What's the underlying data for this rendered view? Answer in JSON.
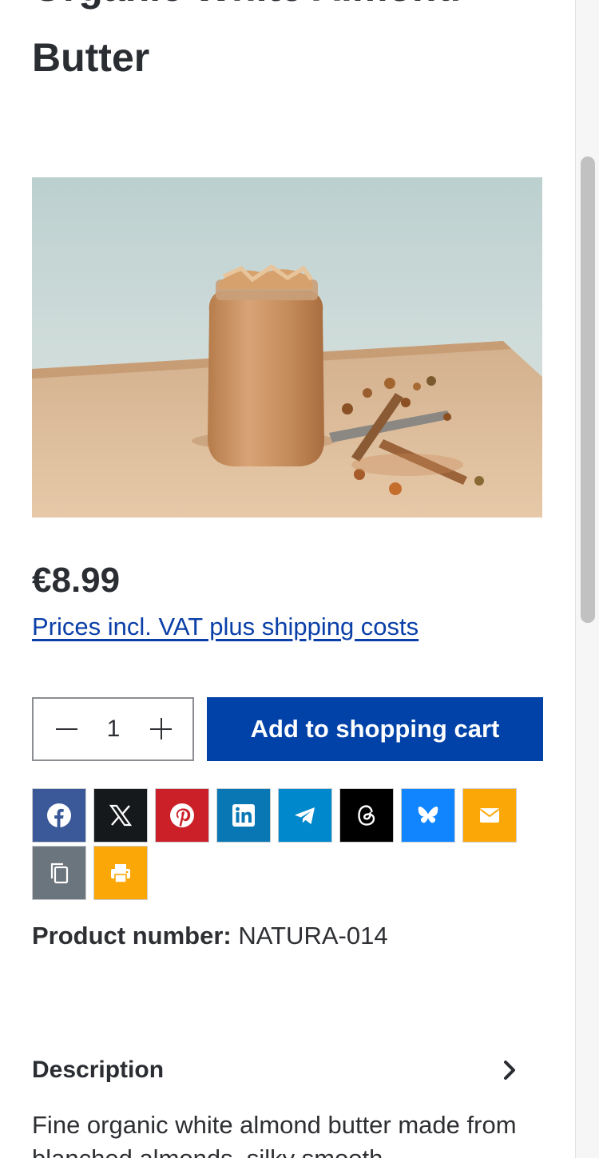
{
  "product": {
    "title": "Organic White Almond Butter",
    "image_alt": "Jar of almond butter on a wooden board",
    "price": "€8.99",
    "vat_link": "Prices incl. VAT plus shipping costs",
    "quantity": "1",
    "add_to_cart": "Add to shopping cart",
    "number_label": "Product number:",
    "number_value": "NATURA-014"
  },
  "share": [
    {
      "name": "facebook",
      "color": "#3b5998"
    },
    {
      "name": "x",
      "color": "#16191c"
    },
    {
      "name": "pinterest",
      "color": "#cb2027"
    },
    {
      "name": "linkedin",
      "color": "#0a77b5"
    },
    {
      "name": "telegram",
      "color": "#0088cc"
    },
    {
      "name": "threads",
      "color": "#000000"
    },
    {
      "name": "bluesky",
      "color": "#1185fe"
    },
    {
      "name": "email",
      "color": "#fca708"
    },
    {
      "name": "copy",
      "color": "#6b757d"
    },
    {
      "name": "print",
      "color": "#fca708"
    }
  ],
  "description": {
    "title": "Description",
    "text": "Fine organic white almond butter made from blanched almonds, silky smooth"
  },
  "colors": {
    "accent": "#0042a8",
    "link": "#0a3fa8",
    "text": "#2d2f33"
  }
}
